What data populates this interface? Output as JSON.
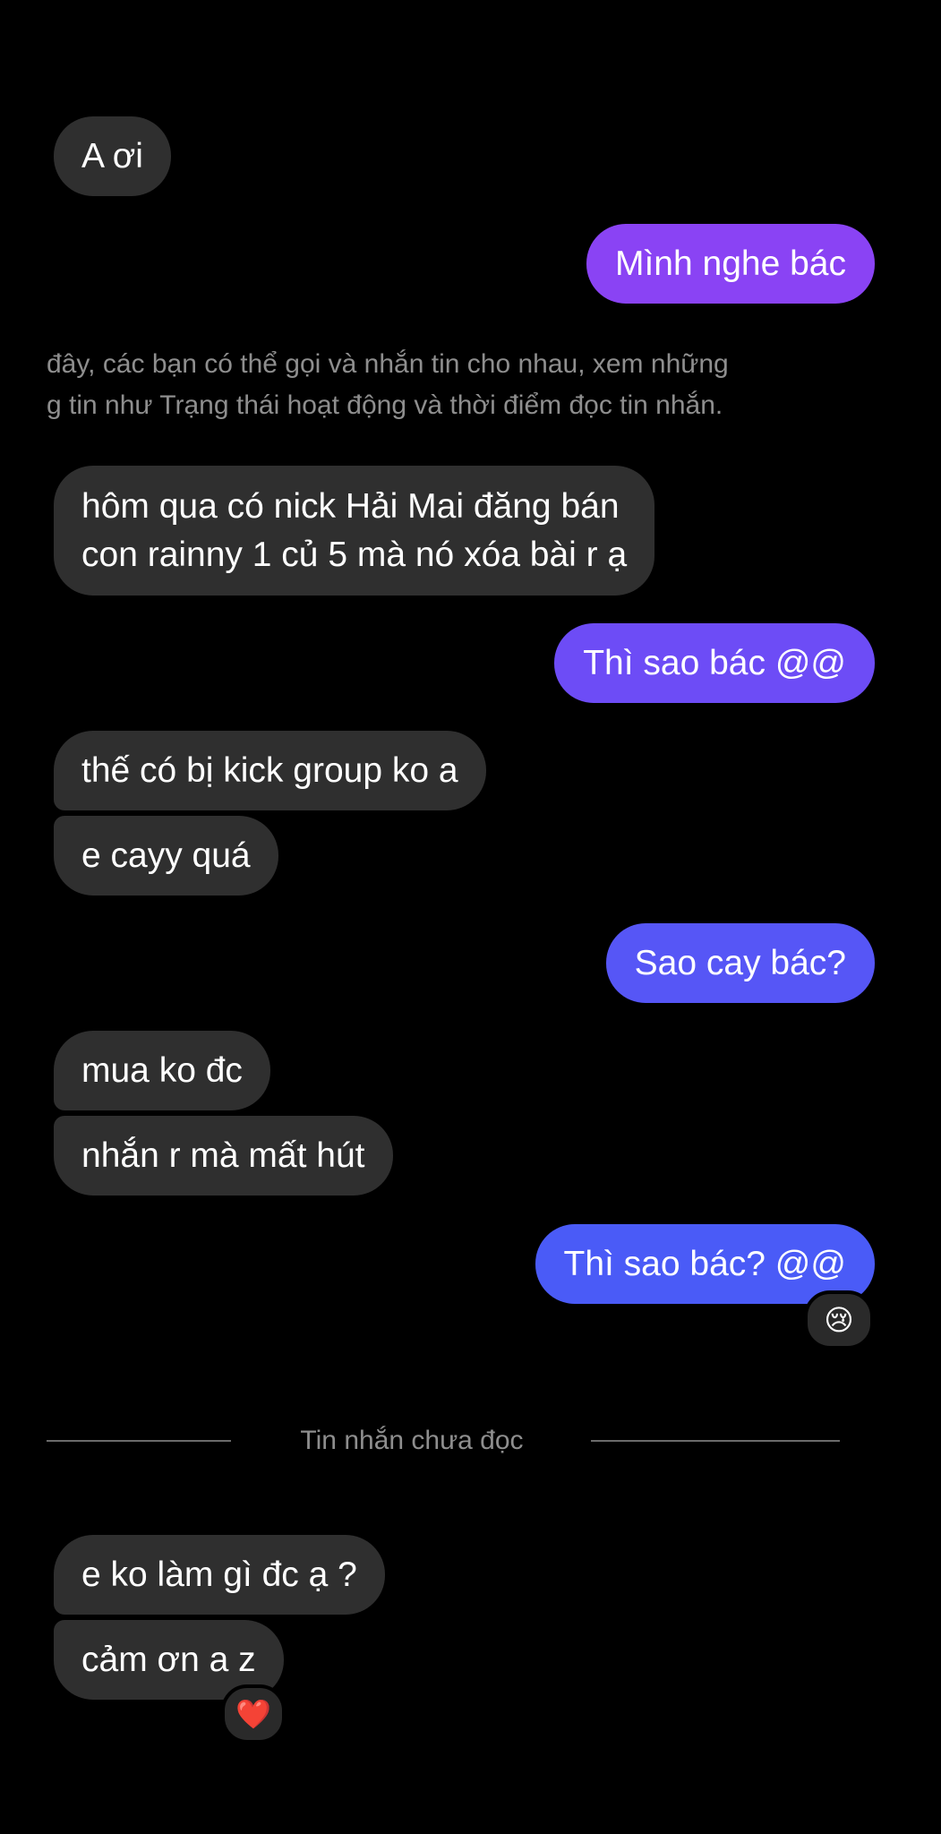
{
  "colors": {
    "background": "#000000",
    "incoming_bubble": "#2f2f2f",
    "outgoing_gradient_top": "#8b3ff5",
    "outgoing_gradient_bottom": "#4a5bf7",
    "secondary_text": "#8e8e8e"
  },
  "messages": [
    {
      "side": "in",
      "text": "A ơi"
    },
    {
      "side": "out",
      "text": "Mình nghe bác"
    },
    {
      "side": "in",
      "text_lines": [
        "hôm qua có nick Hải Mai đăng bán",
        "con rainny 1 củ 5 mà nó xóa bài r ạ"
      ]
    },
    {
      "side": "out",
      "text": "Thì sao bác @@"
    },
    {
      "side": "in",
      "text": "thế có bị kick group ko a"
    },
    {
      "side": "in",
      "text": "e cayy quá"
    },
    {
      "side": "out",
      "text": "Sao cay bác?"
    },
    {
      "side": "in",
      "text": "mua ko đc"
    },
    {
      "side": "in",
      "text": "nhắn r mà mất hút"
    },
    {
      "side": "out",
      "text": "Thì sao bác? @@",
      "reaction": "😢"
    },
    {
      "side": "in",
      "text": "e ko làm gì đc ạ ?"
    },
    {
      "side": "in",
      "text": "cảm ơn a z",
      "reaction": "❤️"
    }
  ],
  "info_notice": {
    "line1": "đây, các bạn có thể gọi và nhắn tin cho nhau, xem những",
    "line2": "g tin như Trạng thái hoạt động và thời điểm đọc tin nhắn."
  },
  "unread_divider": {
    "label": "Tin nhắn chưa đọc"
  }
}
